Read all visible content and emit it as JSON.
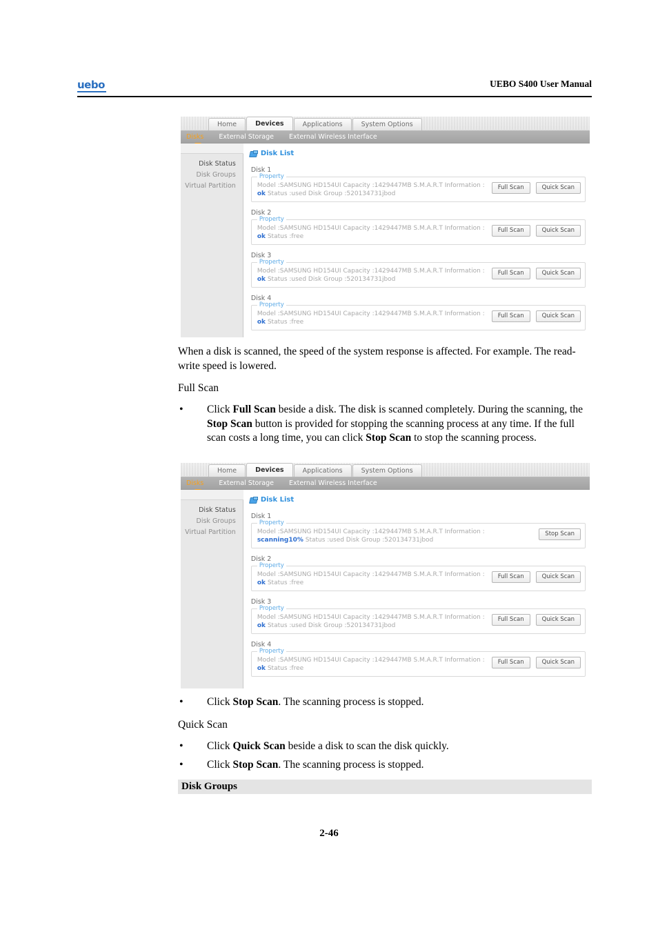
{
  "header": {
    "logo": "uebo",
    "title": "UEBO S400 User Manual"
  },
  "footer": {
    "page_number": "2-46"
  },
  "ui": {
    "tabs": [
      {
        "label": "Home",
        "active": false
      },
      {
        "label": "Devices",
        "active": true
      },
      {
        "label": "Applications",
        "active": false
      },
      {
        "label": "System Options",
        "active": false
      }
    ],
    "subnav": [
      {
        "label": "Disks",
        "active": true
      },
      {
        "label": "External Storage",
        "active": false
      },
      {
        "label": "External Wireless Interface",
        "active": false
      }
    ],
    "sidebar": [
      {
        "label": "Disk Status",
        "active": true
      },
      {
        "label": "Disk Groups",
        "active": false
      },
      {
        "label": "Virtual Partition",
        "active": false
      }
    ],
    "panel_title": "Disk List",
    "panel_icon": "disk-drive-icon",
    "property_legend": "Property",
    "buttons": {
      "full_scan": "Full Scan",
      "quick_scan": "Quick Scan",
      "stop_scan": "Stop Scan"
    }
  },
  "screenshot_1": {
    "disks": [
      {
        "label": "Disk 1",
        "info": "Model :SAMSUNG HD154UI Capacity :1429447MB S.M.A.R.T Information :",
        "status_token": "ok",
        "status_text": " Status :used Disk Group :520134731jbod",
        "buttons": [
          "Full Scan",
          "Quick Scan"
        ]
      },
      {
        "label": "Disk 2",
        "info": "Model :SAMSUNG HD154UI Capacity :1429447MB S.M.A.R.T Information :",
        "status_token": "ok",
        "status_text": " Status :free",
        "buttons": [
          "Full Scan",
          "Quick Scan"
        ]
      },
      {
        "label": "Disk 3",
        "info": "Model :SAMSUNG HD154UI Capacity :1429447MB S.M.A.R.T Information :",
        "status_token": "ok",
        "status_text": " Status :used Disk Group :520134731jbod",
        "buttons": [
          "Full Scan",
          "Quick Scan"
        ]
      },
      {
        "label": "Disk 4",
        "info": "Model :SAMSUNG HD154UI Capacity :1429447MB S.M.A.R.T Information :",
        "status_token": "ok",
        "status_text": " Status :free",
        "buttons": [
          "Full Scan",
          "Quick Scan"
        ]
      }
    ]
  },
  "screenshot_2": {
    "disks": [
      {
        "label": "Disk 1",
        "info": "Model :SAMSUNG HD154UI Capacity :1429447MB S.M.A.R.T Information :",
        "status_token": "scanning10%",
        "status_text": " Status :used Disk Group :520134731jbod",
        "buttons": [
          "Stop Scan"
        ]
      },
      {
        "label": "Disk 2",
        "info": "Model :SAMSUNG HD154UI Capacity :1429447MB S.M.A.R.T Information :",
        "status_token": "ok",
        "status_text": " Status :free",
        "buttons": [
          "Full Scan",
          "Quick Scan"
        ]
      },
      {
        "label": "Disk 3",
        "info": "Model :SAMSUNG HD154UI Capacity :1429447MB S.M.A.R.T Information :",
        "status_token": "ok",
        "status_text": " Status :used Disk Group :520134731jbod",
        "buttons": [
          "Full Scan",
          "Quick Scan"
        ]
      },
      {
        "label": "Disk 4",
        "info": "Model :SAMSUNG HD154UI Capacity :1429447MB S.M.A.R.T Information :",
        "status_token": "ok",
        "status_text": " Status :free",
        "buttons": [
          "Full Scan",
          "Quick Scan"
        ]
      }
    ]
  },
  "body": {
    "intro": "When a disk is scanned, the speed of the system response is affected. For example. The read-write speed is lowered.",
    "full_scan_heading": "Full Scan",
    "quick_scan_heading": "Quick Scan",
    "bullets": [
      {
        "marker": "•",
        "parts": [
          {
            "t": "Click ",
            "b": false
          },
          {
            "t": "Full Scan",
            "b": true
          },
          {
            "t": " beside a disk. The disk is scanned completely. During the scanning, the ",
            "b": false
          },
          {
            "t": "Stop Scan",
            "b": true
          },
          {
            "t": " button is provided for stopping the scanning process at any time. If the full scan costs a long time, you can click ",
            "b": false
          },
          {
            "t": "Stop Scan",
            "b": true
          },
          {
            "t": " to stop the scanning process.",
            "b": false
          }
        ]
      },
      {
        "marker": "•",
        "parts": [
          {
            "t": "Click ",
            "b": false
          },
          {
            "t": "Stop Scan",
            "b": true
          },
          {
            "t": ". The scanning process is stopped.",
            "b": false
          }
        ]
      },
      {
        "marker": "•",
        "parts": [
          {
            "t": "Click ",
            "b": false
          },
          {
            "t": "Quick Scan",
            "b": true
          },
          {
            "t": " beside a disk to scan the disk quickly.",
            "b": false
          }
        ]
      },
      {
        "marker": "•",
        "parts": [
          {
            "t": "Click ",
            "b": false
          },
          {
            "t": "Stop Scan",
            "b": true
          },
          {
            "t": ". The scanning process is stopped.",
            "b": false
          }
        ]
      }
    ],
    "section_heading": "Disk Groups"
  }
}
